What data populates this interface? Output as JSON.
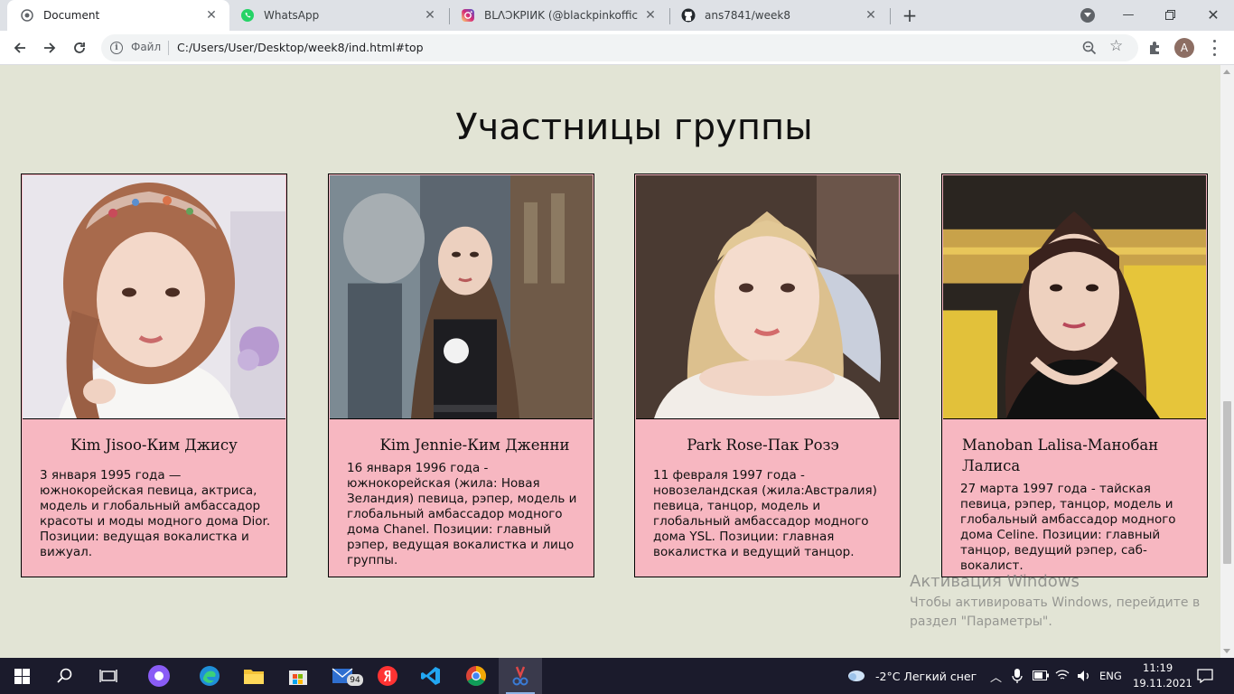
{
  "browser": {
    "tabs": [
      {
        "title": "Document",
        "icon": "chrome-globe-icon",
        "active": true
      },
      {
        "title": "WhatsApp",
        "icon": "whatsapp-icon",
        "active": false
      },
      {
        "title": "BLΛƆKPIИK (@blackpinkofficial) •",
        "icon": "instagram-icon",
        "active": false
      },
      {
        "title": "ans7841/week8",
        "icon": "github-icon",
        "active": false
      }
    ],
    "address": {
      "chip": "Файл",
      "url": "C:/Users/User/Desktop/week8/ind.html#top"
    },
    "avatar_letter": "A"
  },
  "page": {
    "heading": "Участницы группы",
    "members": [
      {
        "name": "Kim Jisoo-Ким Джису",
        "description": "3 января 1995 года — южнокорейская певица, актриса, модель и глобальный амбассадор красоты и моды модного дома Dior. Позиции: ведущая вокалистка и вижуал."
      },
      {
        "name": "Kim Jennie-Ким Дженни",
        "description": "16 января 1996 года - южнокорейская (жила: Новая Зеландия) певица, рэпер, модель и глобальный амбассадор модного дома Chanel. Позиции: главный рэпер, ведущая вокалистка и лицо группы."
      },
      {
        "name": "Park Rose-Пак Розэ",
        "description": "11 февраля 1997 года - новозеландская (жила:Австралия) певица, танцор, модель и глобальный амбассадор модного дома YSL. Позиции: главная вокалистка и ведущий танцор."
      },
      {
        "name": "Manoban Lalisa-Манобан Лалиса",
        "description": "27 марта 1997 года - тайская певица, рэпер, танцор, модель и глобальный амбассадор модного дома Celine. Позиции: главный танцор, ведущий рэпер, саб-вокалист."
      }
    ]
  },
  "watermark": {
    "title": "Активация Windows",
    "line1": "Чтобы активировать Windows, перейдите в",
    "line2": "раздел \"Параметры\"."
  },
  "taskbar": {
    "weather": "-2°C  Легкий снег",
    "language": "ENG",
    "time": "11:19",
    "date": "19.11.2021",
    "mail_badge": "94"
  },
  "colors": {
    "page_bg": "#e2e4d5",
    "card_bg": "#f7b7c1",
    "taskbar_bg": "#1b1b2c"
  }
}
